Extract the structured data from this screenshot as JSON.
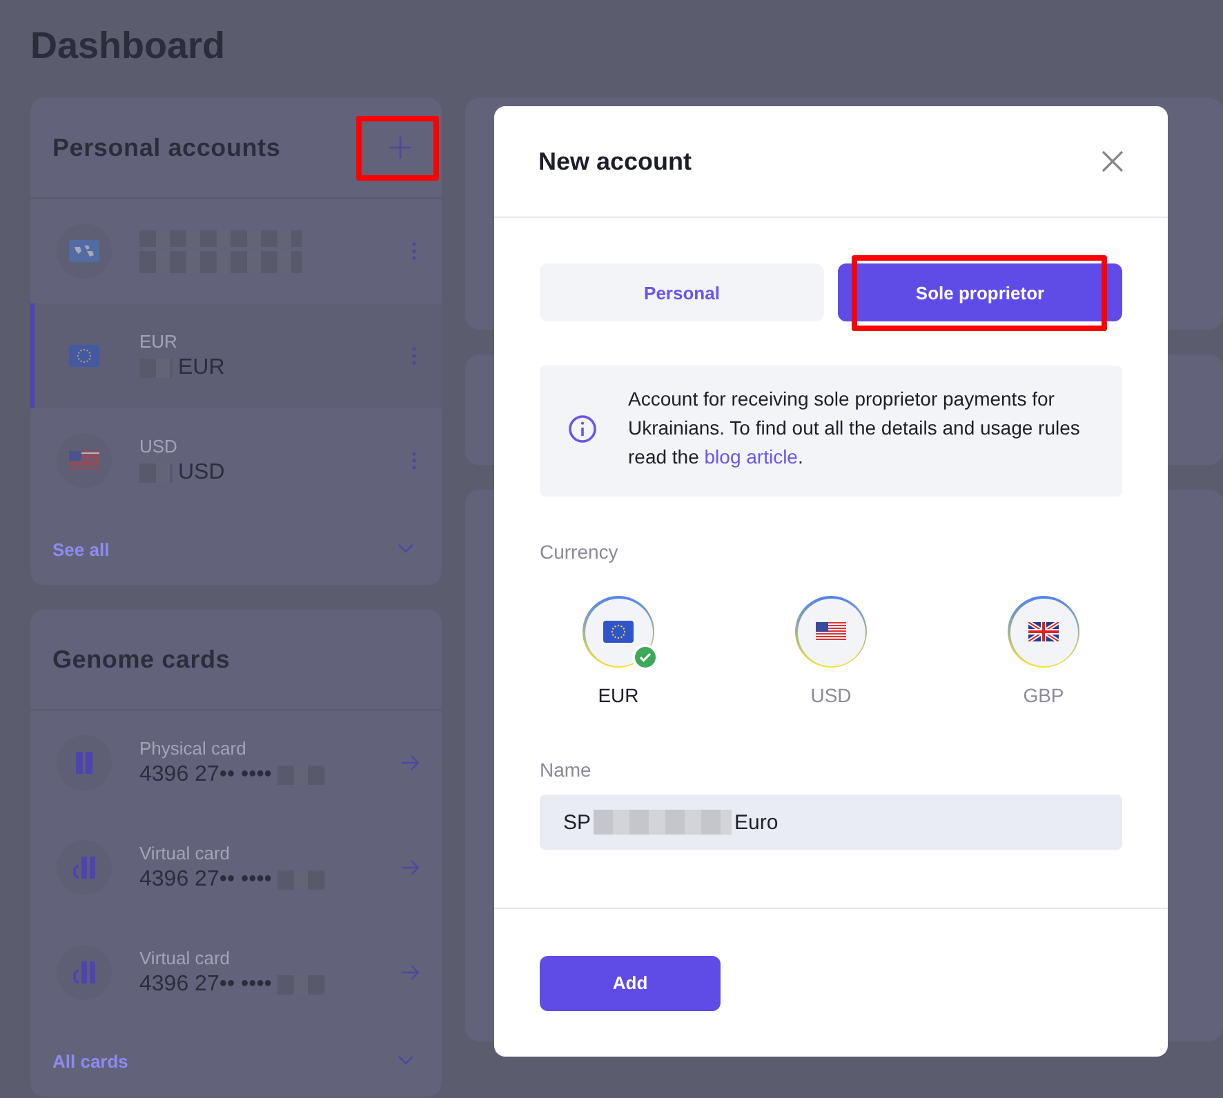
{
  "page": {
    "title": "Dashboard"
  },
  "personal_accounts": {
    "title": "Personal accounts",
    "add_highlighted": true,
    "footer": "See all",
    "rows": [
      {
        "kind": "world",
        "selected": false
      },
      {
        "kind": "eur",
        "label": "EUR",
        "balance": "EUR",
        "selected": true
      },
      {
        "kind": "usd",
        "label": "USD",
        "balance": "USD",
        "selected": false
      }
    ]
  },
  "genome_cards": {
    "title": "Genome cards",
    "footer": "All cards",
    "rows": [
      {
        "kind": "physical",
        "label": "Physical card",
        "number": "4396 27•• ••••"
      },
      {
        "kind": "virtual",
        "label": "Virtual card",
        "number": "4396 27•• ••••"
      },
      {
        "kind": "virtual",
        "label": "Virtual card",
        "number": "4396 27•• ••••"
      }
    ]
  },
  "modal": {
    "title": "New account",
    "tabs": [
      {
        "label": "Personal",
        "selected": false,
        "highlighted": false
      },
      {
        "label": "Sole proprietor",
        "selected": true,
        "highlighted": true
      }
    ],
    "info": {
      "text": "Account for receiving sole proprietor payments for Ukrainians. To find out all the details and usage rules read the",
      "link": "blog article",
      "text_end": "."
    },
    "currency_label": "Currency",
    "currencies": [
      {
        "kind": "eur",
        "code": "EUR",
        "selected": true
      },
      {
        "kind": "usd",
        "code": "USD",
        "selected": false
      },
      {
        "kind": "gbp",
        "code": "GBP",
        "selected": false
      }
    ],
    "name_label": "Name",
    "name_value_start": "SP",
    "name_value_end": "Euro",
    "submit": "Add"
  }
}
